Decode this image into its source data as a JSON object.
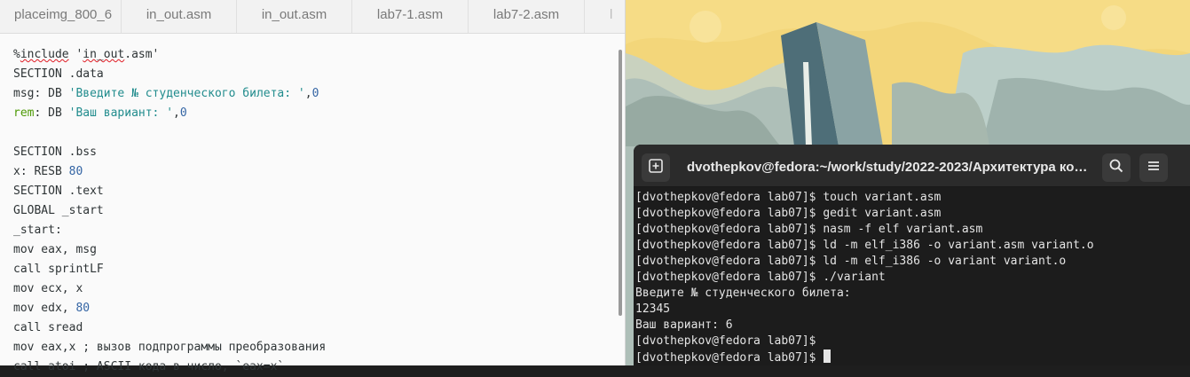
{
  "editor": {
    "tabs": [
      "placeimg_800_6",
      "in_out.asm",
      "in_out.asm",
      "lab7-1.asm",
      "lab7-2.asm",
      "l"
    ],
    "code_lines": [
      [
        {
          "t": "%"
        },
        {
          "t": "include",
          "c": "squiggle"
        },
        {
          "t": " '"
        },
        {
          "t": "in_out",
          "c": "squiggle"
        },
        {
          "t": ".asm'"
        }
      ],
      [
        {
          "t": "SECTION .data"
        }
      ],
      [
        {
          "t": "msg: DB "
        },
        {
          "t": "'Введите № студенческого билета: '",
          "c": "str"
        },
        {
          "t": ","
        },
        {
          "t": "0",
          "c": "num"
        }
      ],
      [
        {
          "t": "rem",
          "c": "kw-green"
        },
        {
          "t": ": DB "
        },
        {
          "t": "'Ваш вариант: '",
          "c": "str"
        },
        {
          "t": ","
        },
        {
          "t": "0",
          "c": "num"
        }
      ],
      [
        {
          "t": ""
        }
      ],
      [
        {
          "t": "SECTION .bss"
        }
      ],
      [
        {
          "t": "x: RESB "
        },
        {
          "t": "80",
          "c": "num"
        }
      ],
      [
        {
          "t": "SECTION .text"
        }
      ],
      [
        {
          "t": "GLOBAL _start"
        }
      ],
      [
        {
          "t": "_start:"
        }
      ],
      [
        {
          "t": "mov eax, msg"
        }
      ],
      [
        {
          "t": "call sprintLF"
        }
      ],
      [
        {
          "t": "mov ecx, x"
        }
      ],
      [
        {
          "t": "mov edx, "
        },
        {
          "t": "80",
          "c": "num"
        }
      ],
      [
        {
          "t": "call sread"
        }
      ],
      [
        {
          "t": "mov eax,x ; вызов подпрограммы преобразования"
        }
      ],
      [
        {
          "t": "call atoi ; ASCII кода в число, `eax=x`"
        }
      ]
    ]
  },
  "terminal": {
    "title": "dvothepkov@fedora:~/work/study/2022-2023/Архитектура ко…",
    "icons": {
      "new_tab": "new-tab-icon",
      "search": "search-icon",
      "menu": "hamburger-menu-icon"
    },
    "lines": [
      "[dvothepkov@fedora lab07]$ touch variant.asm",
      "[dvothepkov@fedora lab07]$ gedit variant.asm",
      "[dvothepkov@fedora lab07]$ nasm -f elf variant.asm",
      "[dvothepkov@fedora lab07]$ ld -m elf_i386 -o variant.asm variant.o",
      "[dvothepkov@fedora lab07]$ ld -m elf_i386 -o variant variant.o",
      "[dvothepkov@fedora lab07]$ ./variant",
      "Введите № студенческого билета:",
      "12345",
      "Ваш вариант: 6",
      "[dvothepkov@fedora lab07]$ ",
      "[dvothepkov@fedora lab07]$ "
    ]
  }
}
